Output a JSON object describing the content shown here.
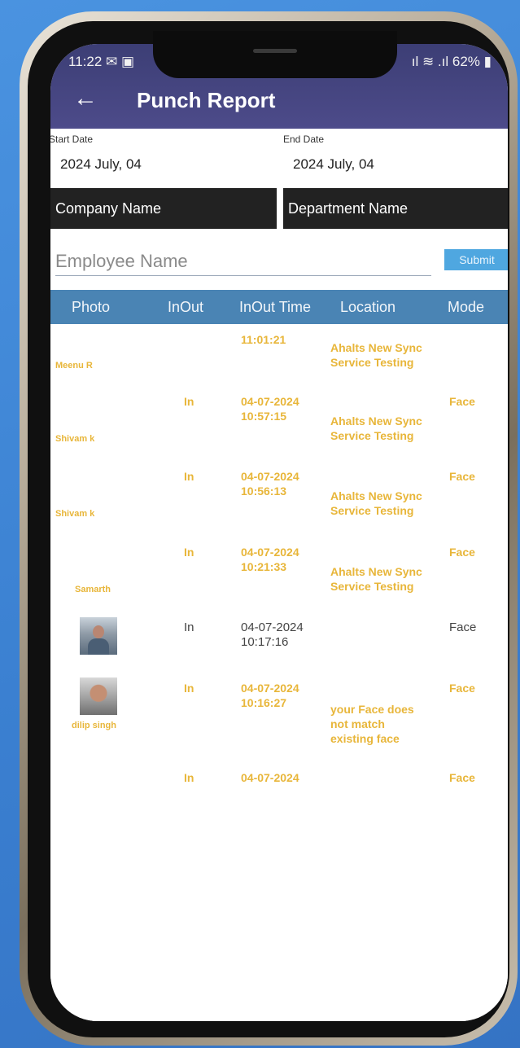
{
  "status_bar": {
    "time": "11:22",
    "left_icons": "✉ ▣",
    "battery": "62%",
    "signal": "ıl ≋ .ıl"
  },
  "app_bar": {
    "title": "Punch Report"
  },
  "filters": {
    "start_date_label": "Start Date",
    "start_date_value": "2024 July, 04",
    "end_date_label": "End Date",
    "end_date_value": "2024 July, 04",
    "company_label": "Company Name",
    "department_label": "Department Name",
    "employee_placeholder": "Employee Name",
    "submit_label": "Submit"
  },
  "table": {
    "headers": [
      "Photo",
      "InOut",
      "InOut Time",
      "Location",
      "Mode"
    ],
    "rows": [
      {
        "name": "Meenu R",
        "inout": "",
        "date": "",
        "time": "11:01:21",
        "location": "Ahalts New Sync Service Testing",
        "mode": "",
        "photo": false,
        "style": "faded"
      },
      {
        "name": "Shivam k",
        "inout": "In",
        "date": "04-07-2024",
        "time": "10:57:15",
        "location": "Ahalts New Sync Service Testing",
        "mode": "Face",
        "photo": false,
        "style": "faded"
      },
      {
        "name": "Shivam k",
        "inout": "In",
        "date": "04-07-2024",
        "time": "10:56:13",
        "location": "Ahalts New Sync Service Testing",
        "mode": "Face",
        "photo": false,
        "style": "faded"
      },
      {
        "name": "Samarth",
        "inout": "In",
        "date": "04-07-2024",
        "time": "10:21:33",
        "location": "Ahalts New Sync Service Testing",
        "mode": "Face",
        "photo": false,
        "style": "faded"
      },
      {
        "name": "",
        "inout": "In",
        "date": "04-07-2024",
        "time": "10:17:16",
        "location": "",
        "mode": "Face",
        "photo": true,
        "style": "normal"
      },
      {
        "name": "dilip singh",
        "inout": "In",
        "date": "04-07-2024",
        "time": "10:16:27",
        "location": "your Face does not match existing face",
        "mode": "Face",
        "photo": true,
        "style": "faded"
      },
      {
        "name": "",
        "inout": "In",
        "date": "04-07-2024",
        "time": "",
        "location": "",
        "mode": "Face",
        "photo": false,
        "style": "faded"
      }
    ]
  }
}
